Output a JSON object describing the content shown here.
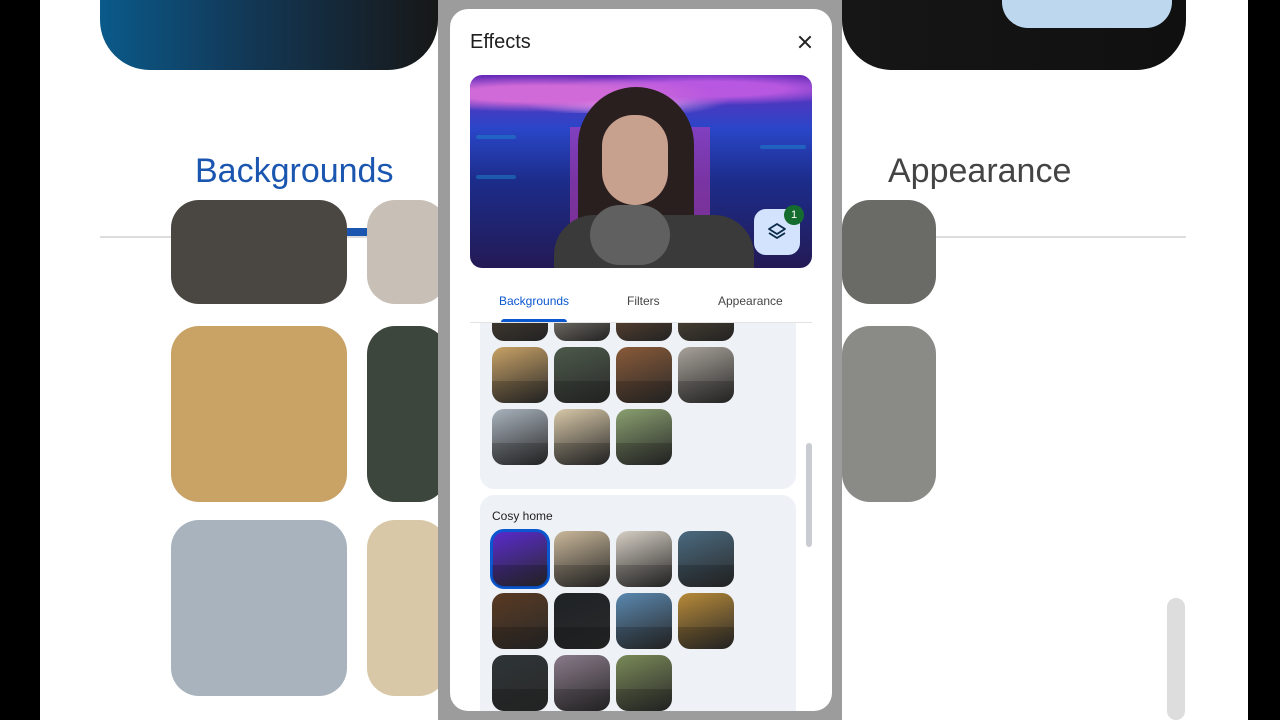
{
  "dialog": {
    "title": "Effects",
    "close_label": "Close",
    "layers_count": "1"
  },
  "tabs": [
    {
      "label": "Backgrounds",
      "active": true
    },
    {
      "label": "Filters",
      "active": false
    },
    {
      "label": "Appearance",
      "active": false
    }
  ],
  "background_tabs": {
    "left": "Backgrounds",
    "right": "Appearance"
  },
  "sections": [
    {
      "label": "",
      "thumbs": [
        {
          "color": "#6b5a48"
        },
        {
          "color": "#d8cfbf"
        },
        {
          "color": "#9a6a4a"
        },
        {
          "color": "#7a6a4e"
        },
        {
          "color": "#c9a266"
        },
        {
          "color": "#4c5a4a"
        },
        {
          "color": "#8a5a38"
        },
        {
          "color": "#a8a29a"
        },
        {
          "color": "#a9b3bd"
        },
        {
          "color": "#d8c8a8"
        },
        {
          "color": "#8aa070"
        }
      ]
    },
    {
      "label": "Cosy home",
      "thumbs": [
        {
          "color": "#5a2ad0",
          "selected": true
        },
        {
          "color": "#cbb89a"
        },
        {
          "color": "#d6cfc4"
        },
        {
          "color": "#4a6a80"
        },
        {
          "color": "#5a3a22"
        },
        {
          "color": "#1e2226"
        },
        {
          "color": "#5a88b0"
        },
        {
          "color": "#b88a38"
        },
        {
          "color": "#2e3436"
        },
        {
          "color": "#8a7a8a"
        },
        {
          "color": "#7a8a58"
        }
      ]
    }
  ]
}
